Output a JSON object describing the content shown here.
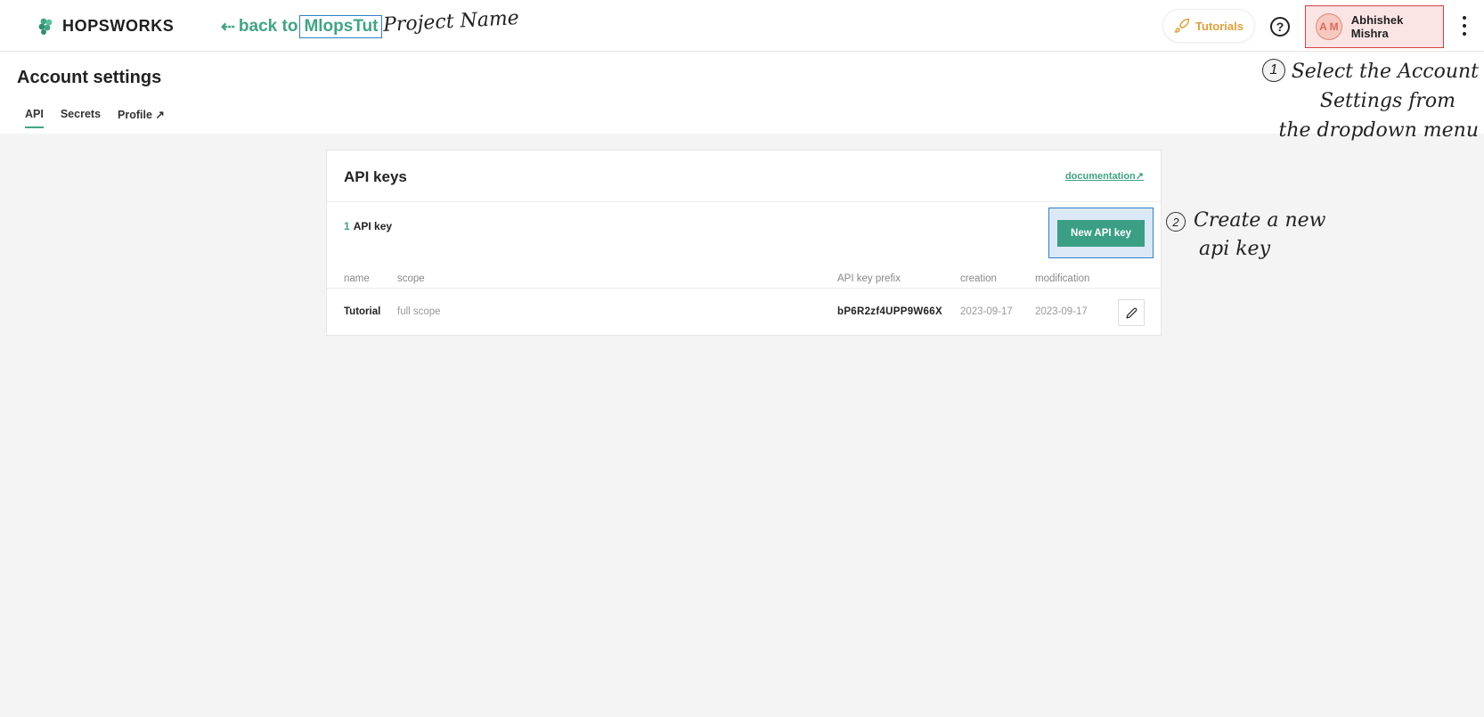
{
  "brand": {
    "name": "HOPSWORKS"
  },
  "nav": {
    "back_label": "back to",
    "project": "MlopsTut"
  },
  "annotations": {
    "project_note": "Project Name",
    "step1_number": "1",
    "step1_lines": [
      "Select the Account",
      "Settings from",
      "the dropdown menu"
    ],
    "step2_number": "2",
    "step2_lines": [
      "Create a new",
      "api key"
    ]
  },
  "header_right": {
    "tutorials_label": "Tutorials",
    "help_symbol": "?",
    "user": {
      "initials": "A M",
      "name": "Abhishek Mishra"
    }
  },
  "page": {
    "title": "Account settings",
    "tabs": [
      {
        "label": "API",
        "active": true
      },
      {
        "label": "Secrets",
        "active": false
      },
      {
        "label": "Profile ↗",
        "active": false
      }
    ]
  },
  "api_panel": {
    "title": "API keys",
    "doc_link": "documentation↗",
    "count": "1",
    "count_label": "API key",
    "new_button": "New API key",
    "columns": {
      "name": "name",
      "scope": "scope",
      "prefix": "API key prefix",
      "creation": "creation",
      "modification": "modification"
    },
    "rows": [
      {
        "name": "Tutorial",
        "scope": "full scope",
        "prefix": "bP6R2zf4UPP9W66X",
        "creation": "2023-09-17",
        "modification": "2023-09-17"
      }
    ]
  },
  "colors": {
    "accent": "#3fa584",
    "highlight_blue": "#2f7fc8",
    "highlight_red": "#d94141",
    "tutorial_orange": "#e0a13a"
  },
  "icons": {
    "logo": "hopsworks-logo-icon",
    "tutorials": "rocket-icon",
    "help": "help-circle-icon",
    "more": "more-vertical-icon",
    "edit": "pencil-icon",
    "back": "arrow-left-icon"
  }
}
